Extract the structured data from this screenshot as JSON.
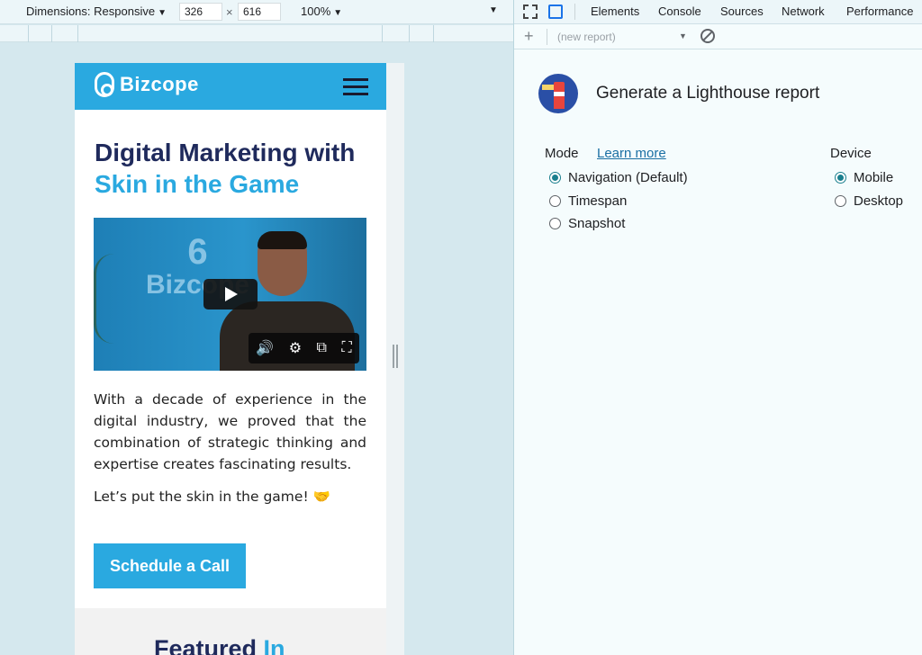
{
  "device_toolbar": {
    "dimensions_label": "Dimensions: Responsive",
    "width": "326",
    "times": "×",
    "height": "616",
    "zoom": "100%"
  },
  "site": {
    "logo_text": "Bizcope",
    "hero_line1": "Digital Marketing with",
    "hero_line2": "Skin in the Game",
    "video_watermark": "Bizcope",
    "description": "With a decade of experience in the digital industry, we proved that the combination of strategic thinking and expertise creates fascinating results.",
    "tagline": "Let’s put the skin in the game! 🤝",
    "cta": "Schedule a Call",
    "featured_title": "Featured",
    "featured_accent": "In",
    "brand_color": "#2aa9e0",
    "dark_color": "#1f2a5c"
  },
  "devtools": {
    "tabs": [
      "Elements",
      "Console",
      "Sources",
      "Network",
      "Performance"
    ],
    "report_placeholder": "(new report)",
    "lighthouse_title": "Generate a Lighthouse report",
    "mode_label": "Mode",
    "learn_more": "Learn more",
    "modes": [
      {
        "label": "Navigation (Default)",
        "selected": true
      },
      {
        "label": "Timespan",
        "selected": false
      },
      {
        "label": "Snapshot",
        "selected": false
      }
    ],
    "device_label": "Device",
    "devices": [
      {
        "label": "Mobile",
        "selected": true
      },
      {
        "label": "Desktop",
        "selected": false
      }
    ]
  }
}
